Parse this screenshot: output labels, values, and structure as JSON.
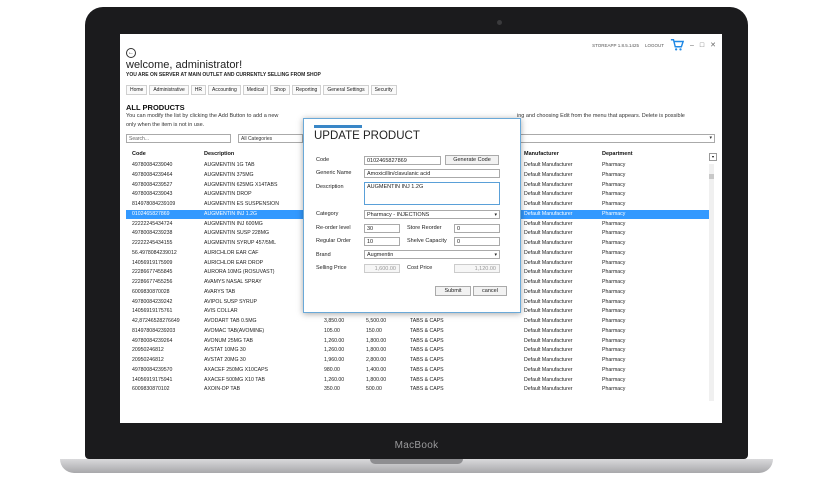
{
  "device": {
    "brand": "MacBook"
  },
  "app": {
    "version_text": "STOREAPP 1.8.5.1425",
    "logout_label": "LOGOUT",
    "window_controls": [
      "–",
      "□",
      "✕"
    ],
    "welcome": "welcome, administrator!",
    "server_line": "YOU ARE ON SERVER AT MAIN OUTLET AND CURRENTLY SELLING FROM SHOP",
    "accent_color": "#3a87c7",
    "selection_color": "#3399ff"
  },
  "nav": [
    "Home",
    "Administrative",
    "HR",
    "Accounting",
    "Medical",
    "Shop",
    "Reporting",
    "General Settings",
    "Security"
  ],
  "page": {
    "title": "ALL PRODUCTS",
    "help_text_1": "You can modify the list by clicking the Add Button to add a new",
    "help_text_1b": "ing and choosing Edit from the menu that appears. Delete is possible",
    "help_text_2": "only when the item is not in use."
  },
  "filters": {
    "search_placeholder": "Search...",
    "category_value": "All Categories"
  },
  "table": {
    "columns": [
      "Code",
      "Description",
      "Manufacturer",
      "Department"
    ],
    "rows": [
      {
        "code": "49780084239040",
        "desc": "AUGMENTIN 1G TAB",
        "cost": "",
        "price": "",
        "cat": "",
        "mfr": "Default Manufacturer",
        "dept": "Pharmacy"
      },
      {
        "code": "49780084239464",
        "desc": "AUGMENTIN 375MG",
        "cost": "",
        "price": "",
        "cat": "",
        "mfr": "Default Manufacturer",
        "dept": "Pharmacy"
      },
      {
        "code": "49780084239527",
        "desc": "AUGMENTIN 625MG X14TABS",
        "cost": "",
        "price": "",
        "cat": "",
        "mfr": "Default Manufacturer",
        "dept": "Pharmacy"
      },
      {
        "code": "49780084239043",
        "desc": "AUGMENTIN DROP",
        "cost": "",
        "price": "",
        "cat": "",
        "mfr": "Default Manufacturer",
        "dept": "Pharmacy"
      },
      {
        "code": "814978084239109",
        "desc": "AUGMENTIN ES SUSPENSION",
        "cost": "",
        "price": "",
        "cat": "",
        "mfr": "Default Manufacturer",
        "dept": "Pharmacy"
      },
      {
        "code": "0102465827869",
        "desc": "AUGMENTIN INJ 1.2G",
        "cost": "",
        "price": "",
        "cat": "",
        "mfr": "Default Manufacturer",
        "dept": "Pharmacy",
        "selected": true
      },
      {
        "code": "22222245434724",
        "desc": "AUGMENTIN INJ 600MG",
        "cost": "",
        "price": "",
        "cat": "",
        "mfr": "Default Manufacturer",
        "dept": "Pharmacy"
      },
      {
        "code": "49780084239238",
        "desc": "AUGMENTIN SUSP 228MG",
        "cost": "",
        "price": "",
        "cat": "",
        "mfr": "Default Manufacturer",
        "dept": "Pharmacy"
      },
      {
        "code": "22222245434155",
        "desc": "AUGMENTIN SYRUP 457/5ML",
        "cost": "",
        "price": "",
        "cat": "",
        "mfr": "Default Manufacturer",
        "dept": "Pharmacy"
      },
      {
        "code": "56.4978084239012",
        "desc": "AURICHLOR EAR CAF",
        "cost": "",
        "price": "",
        "cat": "",
        "mfr": "Default Manufacturer",
        "dept": "Pharmacy"
      },
      {
        "code": "14056919175909",
        "desc": "AURICHLOR EAR DROP",
        "cost": "",
        "price": "",
        "cat": "",
        "mfr": "Default Manufacturer",
        "dept": "Pharmacy"
      },
      {
        "code": "22286677455845",
        "desc": "AURORA 10MG (ROSUVAST)",
        "cost": "",
        "price": "",
        "cat": "",
        "mfr": "Default Manufacturer",
        "dept": "Pharmacy"
      },
      {
        "code": "22286677455256",
        "desc": "AVAMYS NASAL SPRAY",
        "cost": "",
        "price": "",
        "cat": "",
        "mfr": "Default Manufacturer",
        "dept": "Pharmacy"
      },
      {
        "code": "6009830870028",
        "desc": "AVARYS TAB",
        "cost": "",
        "price": "",
        "cat": "",
        "mfr": "Default Manufacturer",
        "dept": "Pharmacy"
      },
      {
        "code": "49780084239242",
        "desc": "AVIPOL SUSP SYRUP",
        "cost": "",
        "price": "",
        "cat": "",
        "mfr": "Default Manufacturer",
        "dept": "Pharmacy"
      },
      {
        "code": "14056919175761",
        "desc": "AVIS COLLAR",
        "cost": "1,260.00",
        "price": "1,800.00",
        "cat": "TABS & CAPS",
        "mfr": "Default Manufacturer",
        "dept": "Pharmacy"
      },
      {
        "code": "42,87246528276649",
        "desc": "AVODART TAB 0.5MG",
        "cost": "3,850.00",
        "price": "5,500.00",
        "cat": "TABS & CAPS",
        "mfr": "Default Manufacturer",
        "dept": "Pharmacy"
      },
      {
        "code": "814978084239203",
        "desc": "AVOMAC TAB(AVOMINE)",
        "cost": "105.00",
        "price": "150.00",
        "cat": "TABS & CAPS",
        "mfr": "Default Manufacturer",
        "dept": "Pharmacy"
      },
      {
        "code": "49780084239264",
        "desc": "AVONUM 25MG TAB",
        "cost": "1,260.00",
        "price": "1,800.00",
        "cat": "TABS & CAPS",
        "mfr": "Default Manufacturer",
        "dept": "Pharmacy"
      },
      {
        "code": "20950246812",
        "desc": "AVSTAT 10MG 30",
        "cost": "1,260.00",
        "price": "1,800.00",
        "cat": "TABS & CAPS",
        "mfr": "Default Manufacturer",
        "dept": "Pharmacy"
      },
      {
        "code": "20950246812",
        "desc": "AVSTAT 20MG 30",
        "cost": "1,960.00",
        "price": "2,800.00",
        "cat": "TABS & CAPS",
        "mfr": "Default Manufacturer",
        "dept": "Pharmacy"
      },
      {
        "code": "49780084239570",
        "desc": "AXACEF 250MG X10CAPS",
        "cost": "980.00",
        "price": "1,400.00",
        "cat": "TABS & CAPS",
        "mfr": "Default Manufacturer",
        "dept": "Pharmacy"
      },
      {
        "code": "14056919175941",
        "desc": "AXACEF 500MG X10 TAB",
        "cost": "1,260.00",
        "price": "1,800.00",
        "cat": "TABS & CAPS",
        "mfr": "Default Manufacturer",
        "dept": "Pharmacy"
      },
      {
        "code": "6009830870102",
        "desc": "AXOIN-DP TAB",
        "cost": "350.00",
        "price": "500.00",
        "cat": "TABS & CAPS",
        "mfr": "Default Manufacturer",
        "dept": "Pharmacy"
      }
    ]
  },
  "modal": {
    "title": "UPDATE PRODUCT",
    "code_label": "Code",
    "code_value": "0102465827869",
    "generate_label": "Generate Code",
    "generic_label": "Generic Name",
    "generic_value": "Amoxicillin/clavulanic acid",
    "description_label": "Description",
    "description_value": "AUGMENTIN INJ 1.2G",
    "category_label": "Category",
    "category_value": "Pharmacy - INJECTIONS",
    "reorder_label": "Re-order level",
    "reorder_value": "30",
    "shelve_reorder_label": "Store Reorder",
    "shelve_reorder_value": "0",
    "regular_order_label": "Regular Order",
    "regular_order_value": "10",
    "shelve_capacity_label": "Shelve Capacity",
    "shelve_capacity_value": "0",
    "brand_label": "Brand",
    "brand_value": "Augmentin",
    "selling_price_label": "Selling Price",
    "selling_price_value": "1,600.00",
    "cost_price_label": "Cost Price",
    "cost_price_value": "1,120.00",
    "submit_label": "Submit",
    "cancel_label": "cancel"
  }
}
